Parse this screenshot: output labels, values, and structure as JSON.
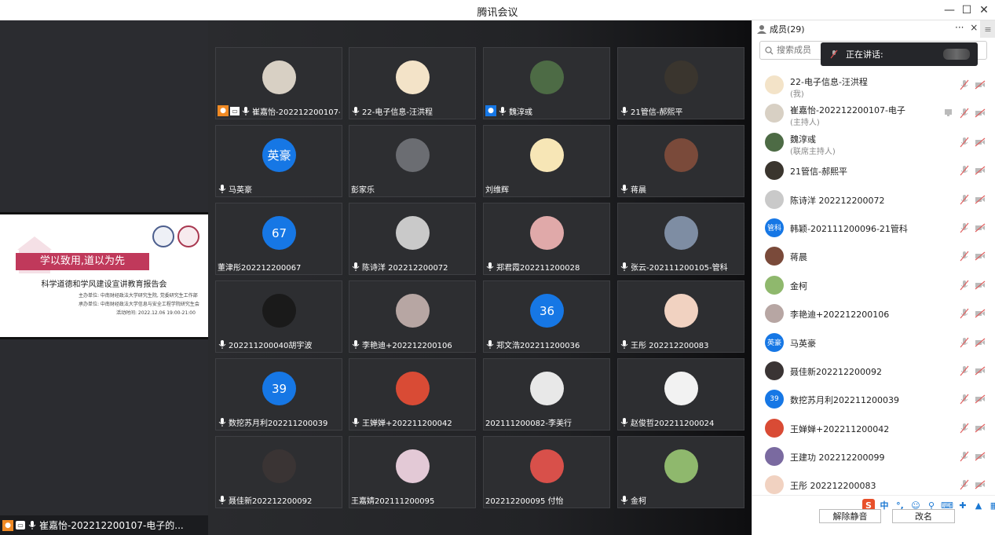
{
  "window": {
    "title": "腾讯会议"
  },
  "stage": {
    "slide": {
      "banner": "学以致用,道以为先",
      "subtitle": "科学道德和学风建设宣讲教育报告会",
      "lines": [
        "主办单位: 中南财经政法大学研究生院, 党委研究生工作部",
        "承办单位: 中南财经政法大学信息与安全工程学院研究生会",
        "活动时间: 2022.12.06 19:00-21:00"
      ]
    },
    "bottom_name": "崔嘉怡-202212200107-电子的..."
  },
  "tiles": [
    {
      "name": "崔嘉怡-202212200107-...",
      "avatar": "photo",
      "color": "#d8d0c4",
      "share": true,
      "mic": true
    },
    {
      "name": "22-电子信息-汪洪程",
      "avatar": "photo",
      "color": "#f3e3c8",
      "mic": true
    },
    {
      "name": "魏淳彧",
      "avatar": "photo",
      "color": "#4d6b45",
      "host_badge": true,
      "mic": true
    },
    {
      "name": "21管信-郝熙平",
      "avatar": "photo",
      "color": "#3a352e",
      "mic": true
    },
    {
      "name": "马英豪",
      "avatar": "text",
      "text": "英豪",
      "color": "#1677e5",
      "mic": true
    },
    {
      "name": "彭家乐",
      "avatar": "photo",
      "color": "#6b6d72",
      "mic": false
    },
    {
      "name": "刘维辉",
      "avatar": "photo",
      "color": "#f7e6b6",
      "mic": false
    },
    {
      "name": "蒋晨",
      "avatar": "photo",
      "color": "#7a4a3a",
      "mic": true
    },
    {
      "name": "董津彤202212200067",
      "avatar": "text",
      "text": "67",
      "color": "#1677e5",
      "mic": false
    },
    {
      "name": "陈诗洋 202212200072",
      "avatar": "photo",
      "color": "#c9c9c9",
      "mic": true
    },
    {
      "name": "郑君霞202211200028",
      "avatar": "photo",
      "color": "#e0a9a9",
      "mic": true
    },
    {
      "name": "张云-202111200105-管科",
      "avatar": "photo",
      "color": "#7e8da3",
      "mic": true
    },
    {
      "name": "202211200040胡宇波",
      "avatar": "photo",
      "color": "#1a1a1a",
      "mic": true
    },
    {
      "name": "李艳迪+202212200106",
      "avatar": "photo",
      "color": "#b7a6a3",
      "mic": true
    },
    {
      "name": "郑文浩202211200036",
      "avatar": "text",
      "text": "36",
      "color": "#1677e5",
      "mic": true
    },
    {
      "name": "王彤 202212200083",
      "avatar": "photo",
      "color": "#f1d2c1",
      "mic": true
    },
    {
      "name": "数挖苏月利202211200039",
      "avatar": "text",
      "text": "39",
      "color": "#1677e5",
      "mic": true
    },
    {
      "name": "王婵婵+202211200042",
      "avatar": "photo",
      "color": "#d94b35",
      "mic": true
    },
    {
      "name": "202111200082-李美行",
      "avatar": "photo",
      "color": "#e8e8e8",
      "mic": false
    },
    {
      "name": "赵俊哲202211200024",
      "avatar": "photo",
      "color": "#f2f2f2",
      "mic": true
    },
    {
      "name": "聂佳新202212200092",
      "avatar": "photo",
      "color": "#3a3434",
      "mic": true
    },
    {
      "name": "王嘉婧202111200095",
      "avatar": "photo",
      "color": "#e3c9d6",
      "mic": false
    },
    {
      "name": "202212200095 付怡",
      "avatar": "photo",
      "color": "#d8504a",
      "mic": false
    },
    {
      "name": "金柯",
      "avatar": "photo",
      "color": "#8fb86d",
      "mic": true
    }
  ],
  "panel": {
    "title": "成员(29)",
    "more": "···",
    "close": "×",
    "search_placeholder": "搜索成员",
    "speaking_label": "正在讲话:",
    "members": [
      {
        "name": "22-电子信息-汪洪程",
        "role": "(我)",
        "avatar": "photo",
        "color": "#f3e3c8"
      },
      {
        "name": "崔嘉怡-202212200107-电子",
        "role": "(主持人)",
        "avatar": "photo",
        "color": "#d8d0c4",
        "screen": true
      },
      {
        "name": "魏淳彧",
        "role": "(联席主持人)",
        "avatar": "photo",
        "color": "#4d6b45"
      },
      {
        "name": "21管信-郝熙平",
        "role": "",
        "avatar": "photo",
        "color": "#3a352e"
      },
      {
        "name": "陈诗洋 202212200072",
        "role": "",
        "avatar": "photo",
        "color": "#c9c9c9"
      },
      {
        "name": "韩颖-202111200096-21管科",
        "role": "",
        "avatar": "text",
        "text": "管科",
        "color": "#1677e5"
      },
      {
        "name": "蒋晨",
        "role": "",
        "avatar": "photo",
        "color": "#7a4a3a"
      },
      {
        "name": "金柯",
        "role": "",
        "avatar": "photo",
        "color": "#8fb86d"
      },
      {
        "name": "李艳迪+202212200106",
        "role": "",
        "avatar": "photo",
        "color": "#b7a6a3"
      },
      {
        "name": "马英豪",
        "role": "",
        "avatar": "text",
        "text": "英豪",
        "color": "#1677e5"
      },
      {
        "name": "聂佳新202212200092",
        "role": "",
        "avatar": "photo",
        "color": "#3a3434"
      },
      {
        "name": "数挖苏月利202211200039",
        "role": "",
        "avatar": "text",
        "text": "39",
        "color": "#1677e5"
      },
      {
        "name": "王婵婵+202211200042",
        "role": "",
        "avatar": "photo",
        "color": "#d94b35"
      },
      {
        "name": "王建功 202212200099",
        "role": "",
        "avatar": "photo",
        "color": "#7a6aa0"
      },
      {
        "name": "王彤 202212200083",
        "role": "",
        "avatar": "photo",
        "color": "#f1d2c1"
      }
    ],
    "unmute_label": "解除静音",
    "rename_label": "改名",
    "ime_char": "中"
  }
}
